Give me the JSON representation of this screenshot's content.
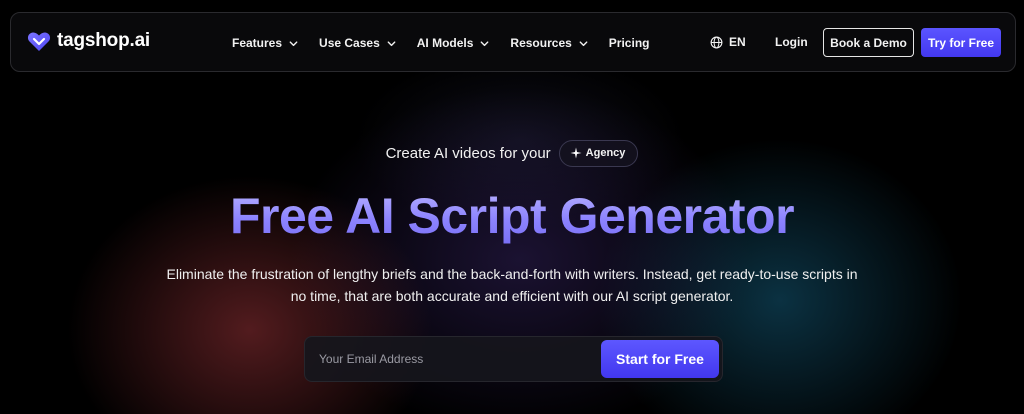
{
  "nav": {
    "logo_text": "tagshop.ai",
    "links": [
      {
        "label": "Features",
        "dropdown": true
      },
      {
        "label": "Use Cases",
        "dropdown": true
      },
      {
        "label": "AI Models",
        "dropdown": true
      },
      {
        "label": "Resources",
        "dropdown": true
      },
      {
        "label": "Pricing",
        "dropdown": false
      }
    ],
    "language": "EN",
    "login_label": "Login",
    "demo_label": "Book a Demo",
    "try_label": "Try for Free"
  },
  "hero": {
    "tagline": "Create AI videos for your",
    "chip_label": "Agency",
    "headline": "Free AI Script Generator",
    "description_line1": "Eliminate the frustration of lengthy briefs and the back-and-forth with writers. Instead, get ready-to-use scripts in",
    "description_line2": "no time, that are both accurate and efficient with our AI script generator.",
    "email_placeholder": "Your Email Address",
    "cta_label": "Start for Free"
  },
  "icons": {
    "logo": "heart-tag-icon",
    "dropdown": "chevron-down-icon",
    "language": "globe-icon",
    "chip": "sparkle-icon"
  },
  "colors": {
    "accent": "#4f46f5",
    "headline_gradient_top": "#b9b3ff",
    "headline_gradient_bottom": "#7a70f5",
    "background": "#000000"
  }
}
